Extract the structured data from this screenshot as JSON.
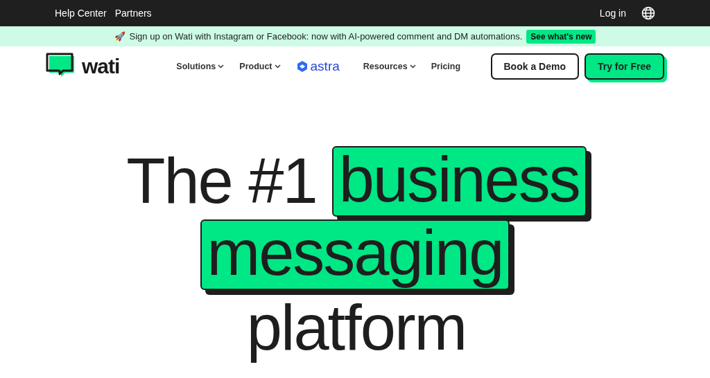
{
  "top_bar": {
    "links": [
      "Help Center",
      "Partners"
    ],
    "login": "Log in"
  },
  "announcement": {
    "icon": "🚀",
    "text": "Sign up on Wati with Instagram or Facebook: now with AI-powered comment and DM automations.",
    "cta": "See what's new"
  },
  "nav": {
    "logo": "wati",
    "items": [
      {
        "kind": "dropdown",
        "label": "Solutions"
      },
      {
        "kind": "dropdown",
        "label": "Product"
      },
      {
        "kind": "brand",
        "label": "astra"
      },
      {
        "kind": "dropdown",
        "label": "Resources"
      },
      {
        "kind": "link",
        "label": "Pricing"
      }
    ],
    "buttons": [
      {
        "label": "Book a Demo",
        "kind": "outline"
      },
      {
        "label": "Try for Free",
        "kind": "primary"
      }
    ]
  },
  "hero": {
    "lines": [
      [
        {
          "text": "The #1",
          "highlighted": false
        },
        {
          "text": "business",
          "highlighted": true
        }
      ],
      [
        {
          "text": "messaging",
          "highlighted": true
        }
      ],
      [
        {
          "text": "platform",
          "highlighted": false
        }
      ]
    ]
  }
}
